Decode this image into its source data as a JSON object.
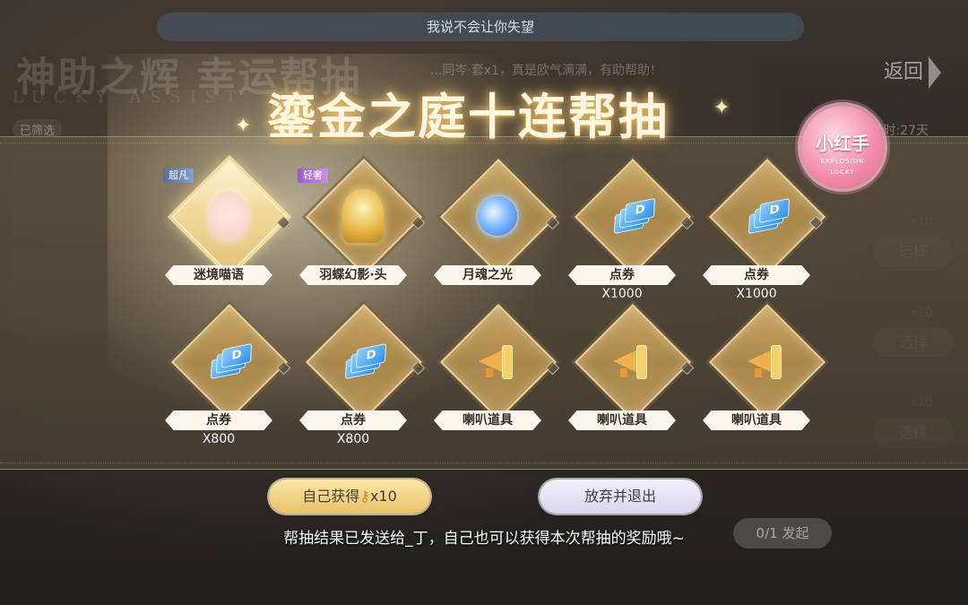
{
  "top_banner": "我说不会让你失望",
  "background": {
    "event_title": "神助之辉 幸运帮抽",
    "event_subtitle": "LUCKY ASSIST",
    "notice": "...同岑·套x1，真是欧气满满，有助帮助！",
    "back_label": "返回",
    "filter_label": "已筛选",
    "countdown": "倒计时:27天",
    "select_label": "选择",
    "x10": "x10",
    "send_label": "发起",
    "send_count": "0/1"
  },
  "overlay": {
    "title": "鎏金之庭十连帮抽",
    "badge_main": "小红手",
    "badge_sub_1": "EXPLOSION",
    "badge_sub_2": "LUCKY"
  },
  "rewards": [
    {
      "name": "迷境喵语",
      "tag": "超凡",
      "icon": "makeup-face-icon"
    },
    {
      "name": "羽蝶幻影·头",
      "tag": "轻奢",
      "icon": "hair-icon"
    },
    {
      "name": "月魂之光",
      "icon": "moon-orb-icon"
    },
    {
      "name": "点券",
      "qty": "X1000",
      "icon": "coupon-icon"
    },
    {
      "name": "点券",
      "qty": "X1000",
      "icon": "coupon-icon"
    },
    {
      "name": "点券",
      "qty": "X800",
      "icon": "coupon-icon"
    },
    {
      "name": "点券",
      "qty": "X800",
      "icon": "coupon-icon"
    },
    {
      "name": "喇叭道具",
      "icon": "horn-icon"
    },
    {
      "name": "喇叭道具",
      "icon": "horn-icon"
    },
    {
      "name": "喇叭道具",
      "icon": "horn-icon"
    }
  ],
  "actions": {
    "self_obtain_label": "自己获得",
    "self_obtain_count": "x10",
    "quit_label": "放弃并退出"
  },
  "message": "帮抽结果已发送给_丁，自己也可以获得本次帮抽的奖励哦~"
}
